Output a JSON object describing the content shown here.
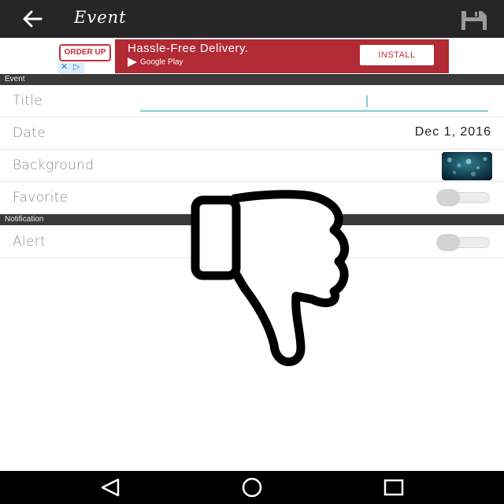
{
  "colors": {
    "app_bar": "#262626",
    "ad_red": "#b22a34",
    "accent_teal": "#7fd0cf",
    "section_header": "#3a3a3a",
    "nav_bar": "#000000"
  },
  "app_bar": {
    "title": "Event",
    "back_icon": "arrow-left-icon",
    "save_icon": "floppy-disk-icon"
  },
  "ad": {
    "logo_text": "ORDER UP",
    "headline": "Hassle-Free Delivery.",
    "store": "Google Play",
    "install_label": "INSTALL",
    "close_icons": [
      "close-icon",
      "adchoices-icon"
    ]
  },
  "sections": {
    "event": "Event",
    "notification": "Notification"
  },
  "rows": {
    "title": {
      "label": "Title",
      "value": ""
    },
    "date": {
      "label": "Date",
      "value": "Dec 1, 2016"
    },
    "background": {
      "label": "Background"
    },
    "favorite": {
      "label": "Favorite",
      "on": false
    },
    "alert": {
      "label": "Alert",
      "on": false
    }
  },
  "overlay": {
    "icon": "thumbs-down-icon"
  },
  "nav": {
    "back_icon": "nav-back-icon",
    "home_icon": "nav-home-icon",
    "recents_icon": "nav-recents-icon"
  }
}
